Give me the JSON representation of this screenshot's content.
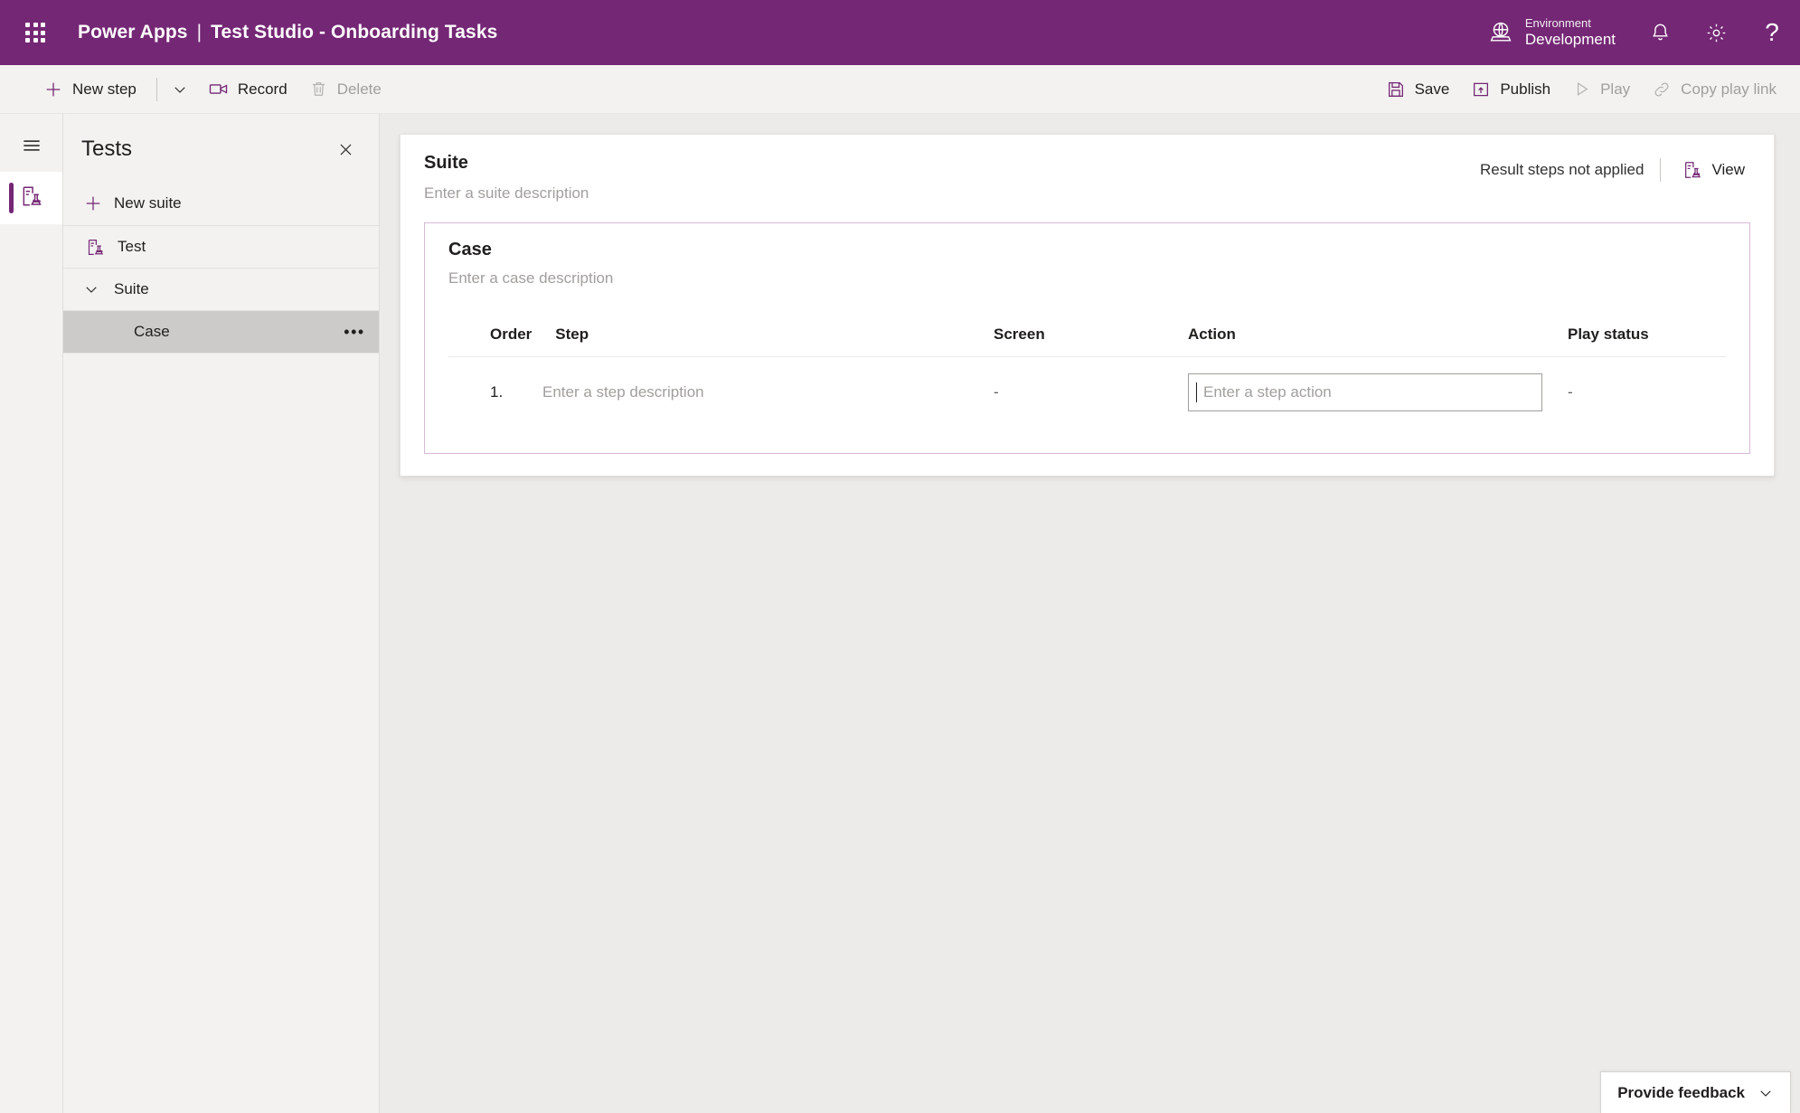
{
  "header": {
    "waffle_icon": "app-launcher-icon",
    "brand": "Power Apps",
    "separator": "|",
    "page_title": "Test Studio - Onboarding Tasks",
    "environment": {
      "icon": "environment-globe-icon",
      "label": "Environment",
      "value": "Development"
    },
    "notifications_icon": "bell-icon",
    "settings_icon": "gear-icon",
    "help_icon": "question-mark-icon",
    "background_color": "#742774"
  },
  "command_bar": {
    "new_step": {
      "label": "New step",
      "icon": "plus-icon",
      "enabled": true
    },
    "new_step_caret": {
      "icon": "chevron-down-icon",
      "enabled": true
    },
    "record": {
      "label": "Record",
      "icon": "video-camera-icon",
      "enabled": true
    },
    "delete": {
      "label": "Delete",
      "icon": "trash-icon",
      "enabled": false
    },
    "save": {
      "label": "Save",
      "icon": "save-disk-icon",
      "enabled": true
    },
    "publish": {
      "label": "Publish",
      "icon": "publish-icon",
      "enabled": true
    },
    "play": {
      "label": "Play",
      "icon": "play-triangle-icon",
      "enabled": false
    },
    "copy_play_link": {
      "label": "Copy play link",
      "icon": "link-icon",
      "enabled": false
    }
  },
  "rail": {
    "hamburger_icon": "hamburger-menu-icon",
    "tests_icon": "test-beaker-icon",
    "accent_color": "#742774"
  },
  "tests_panel": {
    "title": "Tests",
    "close_icon": "close-icon",
    "new_suite": {
      "label": "New suite",
      "icon": "plus-icon"
    },
    "tree": [
      {
        "label": "Test",
        "icon": "test-beaker-icon",
        "level": "test",
        "selected": false
      },
      {
        "label": "Suite",
        "icon": "chevron-down-icon",
        "level": "suite",
        "selected": false
      },
      {
        "label": "Case",
        "icon": "",
        "level": "case",
        "selected": true,
        "more_label": "•••"
      }
    ]
  },
  "suite_card": {
    "title": "Suite",
    "description_placeholder": "Enter a suite description",
    "status_text": "Result steps not applied",
    "view_button": {
      "label": "View",
      "icon": "test-beaker-icon"
    }
  },
  "case_card": {
    "title": "Case",
    "description_placeholder": "Enter a case description",
    "border_color": "#d7b9d7",
    "table": {
      "columns": [
        "Order",
        "Step",
        "Screen",
        "Action",
        "Play status"
      ],
      "rows": [
        {
          "order": "1.",
          "step_placeholder": "Enter a step description",
          "screen": "-",
          "action_placeholder": "Enter a step action",
          "play_status": "-"
        }
      ]
    }
  },
  "feedback": {
    "label": "Provide feedback",
    "icon": "chevron-down-icon"
  }
}
